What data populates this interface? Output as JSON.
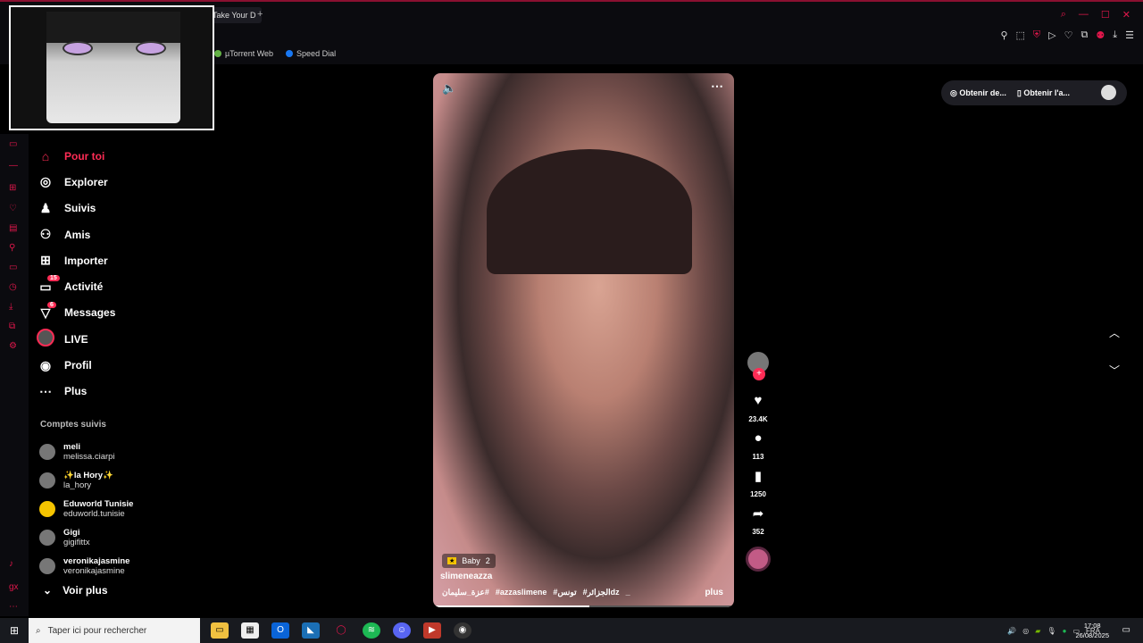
{
  "browser": {
    "tab_title": "Take Your D",
    "new_tab": "+",
    "bookmarks": [
      {
        "label": "µTorrent Web",
        "color": "#64b246"
      },
      {
        "label": "Speed Dial",
        "color": "#1877f2"
      }
    ]
  },
  "nav": {
    "items": [
      {
        "label": "Pour toi",
        "icon": "home-icon",
        "glyph": "⌂"
      },
      {
        "label": "Explorer",
        "icon": "compass-icon",
        "glyph": "◎"
      },
      {
        "label": "Suivis",
        "icon": "following-icon",
        "glyph": "♟"
      },
      {
        "label": "Amis",
        "icon": "friends-icon",
        "glyph": "⚇"
      },
      {
        "label": "Importer",
        "icon": "upload-icon",
        "glyph": "⊞"
      },
      {
        "label": "Activité",
        "icon": "activity-icon",
        "glyph": "▭",
        "badge": "15"
      },
      {
        "label": "Messages",
        "icon": "messages-icon",
        "glyph": "▽",
        "badge": "6"
      },
      {
        "label": "LIVE",
        "icon": "live-icon"
      },
      {
        "label": "Profil",
        "icon": "profile-icon",
        "glyph": "◉"
      },
      {
        "label": "Plus",
        "icon": "more-icon",
        "glyph": "⋯"
      }
    ]
  },
  "followed": {
    "title": "Comptes suivis",
    "accounts": [
      {
        "name": "meli",
        "user": "melissa.ciarpi"
      },
      {
        "name": "✨la Hory✨",
        "user": "la_hory"
      },
      {
        "name": "Eduworld Tunisie",
        "user": "eduworld.tunisie"
      },
      {
        "name": "Gigi",
        "user": "gigifittx"
      },
      {
        "name": "veronikajasmine",
        "user": "veronikajasmine"
      }
    ],
    "see_more": "Voir plus"
  },
  "video": {
    "music": "Baby",
    "music_count": "2",
    "author": "slimeneazza",
    "tags": [
      "عزة_سليمان#",
      "#azzaslimene",
      "#تونس",
      "#الجزائرdz",
      "_"
    ],
    "more": "plus",
    "progress_fraction": 0.52
  },
  "actions": {
    "likes": "23.4K",
    "comments": "113",
    "saves": "1250",
    "shares": "352"
  },
  "top_buttons": {
    "btn1": "Obtenir de...",
    "btn2": "Obtenir l'a..."
  },
  "taskbar": {
    "search_placeholder": "Taper ici pour rechercher",
    "lang": "FRA",
    "time": "17:08",
    "date": "26/08/2025"
  }
}
